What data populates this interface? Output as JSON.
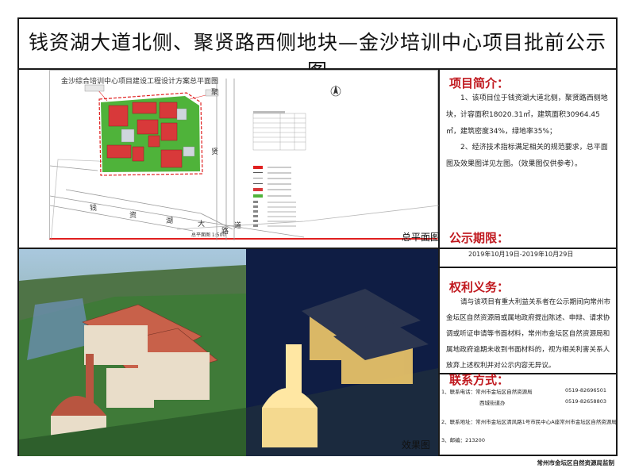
{
  "title": "钱资湖大道北侧、聚贤路西侧地块—金沙培训中心项目批前公示图",
  "site_plan": {
    "title": "金沙综合培训中心项目建设工程设计方案总平面图",
    "road_chars_bottom": [
      "钱",
      "资",
      "湖",
      "大",
      "道"
    ],
    "road_chars_side": [
      "聚",
      "贤",
      "路"
    ],
    "bottom_label": "总平面图 1:500",
    "label": "总平面图"
  },
  "render_label": "效果图",
  "sections": {
    "intro_head": "项目简介：",
    "intro_p1": "1、该项目位于钱资湖大道北侧，聚贤路西侧地块，计容面积18020.31㎡，建筑面积30964.45㎡，建筑密度34%，绿地率35%；",
    "intro_p2": "2、经济技术指标满足相关的规范要求，总平面图及效果图详见左图。（效果图仅供参考）。",
    "period_head": "公示期限：",
    "period": "2019年10月19日-2019年10月29日",
    "rights_head": "权利义务：",
    "rights_p": "请与该项目有重大利益关系者在公示期间向常州市金坛区自然资源局或属地政府提出陈述、申辩、请求协调或听证申请等书面材料，常州市金坛区自然资源局和属地政府逾期未收到书面材料的，视为相关利害关系人放弃上述权利并对公示内容无异议。",
    "contact_head": "联系方式：",
    "contact_l1": "1、联系电话：常州市金坛区自然资源局",
    "contact_l1_tel": "0519-82696501",
    "contact_l2": "西城街道办",
    "contact_l2_tel": "0519-82658803",
    "contact_l3": "2、联系地址：常州市金坛区清风路1号市民中心A座常州市金坛区自然资源局",
    "contact_l4": "3、邮编：213200"
  },
  "footer": "常州市金坛区自然资源局监制",
  "colors": {
    "accent_red": "#c0181e",
    "frame": "#1a1a1a"
  }
}
